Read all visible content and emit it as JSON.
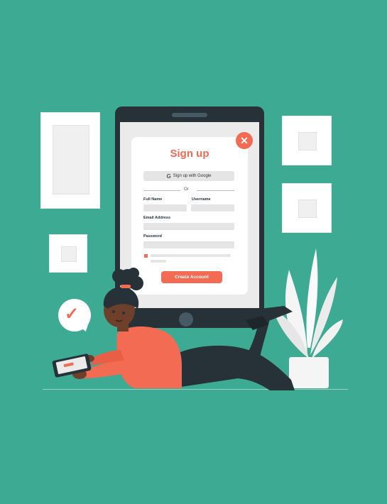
{
  "signup_form": {
    "title": "Sign up",
    "close_icon": "✕",
    "google_label": "Sign up with Google",
    "google_icon": "G",
    "divider_text": "Or",
    "full_name_label": "Full Name",
    "username_label": "Username",
    "email_label": "Email Address",
    "password_label": "Password",
    "create_button_label": "Create Account"
  },
  "illustration": {
    "checkmark_icon": "✓"
  },
  "colors": {
    "background": "#3daa93",
    "accent": "#f26b52",
    "device": "#263238",
    "skin": "#6e3f2a"
  }
}
